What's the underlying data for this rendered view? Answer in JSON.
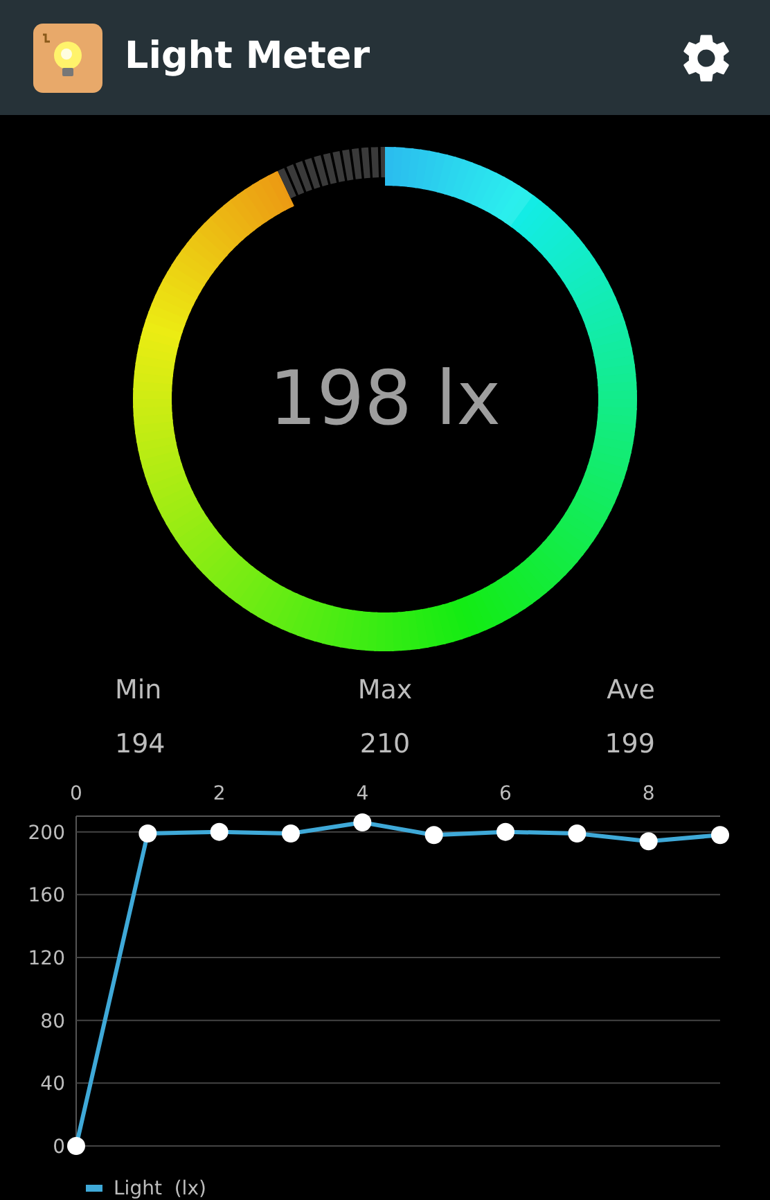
{
  "app_bar": {
    "title": "Light Meter"
  },
  "gauge": {
    "reading": "198 lx"
  },
  "stats": [
    {
      "label": "Min",
      "value": "194"
    },
    {
      "label": "Max",
      "value": "210"
    },
    {
      "label": "Ave",
      "value": "199"
    }
  ],
  "chart_data": {
    "type": "line",
    "x": [
      0,
      1,
      2,
      3,
      4,
      5,
      6,
      7,
      8,
      9
    ],
    "xlim": [
      0,
      9
    ],
    "xticks": [
      0,
      2,
      4,
      6,
      8
    ],
    "ylim": [
      0,
      210
    ],
    "grid": true,
    "yticks": [
      0,
      40,
      80,
      120,
      160,
      200
    ],
    "series": [
      {
        "name": "Light  (lx)",
        "color": "#3fa9d8",
        "marker": true,
        "values": [
          0,
          199,
          200,
          199,
          206,
          198,
          200,
          199,
          194,
          198
        ]
      }
    ]
  }
}
